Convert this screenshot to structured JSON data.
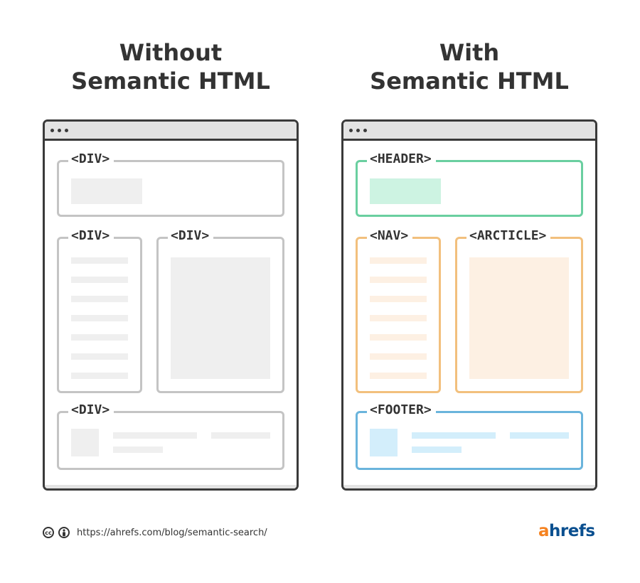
{
  "left": {
    "title_line1": "Without",
    "title_line2": "Semantic HTML",
    "tags": {
      "top": "<DIV>",
      "side": "<DIV>",
      "main": "<DIV>",
      "bottom": "<DIV>"
    }
  },
  "right": {
    "title_line1": "With",
    "title_line2": "Semantic HTML",
    "tags": {
      "top": "<HEADER>",
      "side": "<NAV>",
      "main": "<ARCTICLE>",
      "bottom": "<FOOTER>"
    }
  },
  "colors": {
    "neutral_border": "#c4c4c4",
    "neutral_fill": "#efefef",
    "header_border": "#6acfa0",
    "header_fill": "#cdf3e2",
    "nav_border": "#f2c07d",
    "nav_fill": "#fdf0e3",
    "footer_border": "#6ab4dc",
    "footer_fill": "#d3eefb",
    "logo_a": "#f58220",
    "logo_rest": "#0a4f8f"
  },
  "footer": {
    "url": "https://ahrefs.com/blog/semantic-search/",
    "logo_a": "a",
    "logo_rest": "hrefs",
    "cc_icon_text": "cc"
  }
}
